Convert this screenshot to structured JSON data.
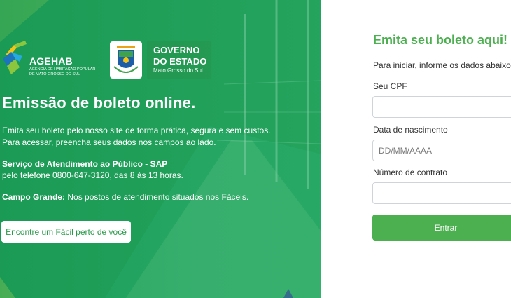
{
  "hero": {
    "agehab": {
      "name": "AGEHAB",
      "subtitle": "AGÊNCIA DE HABITAÇÃO POPULAR DE MATO GROSSO DO SUL"
    },
    "governo": {
      "line1": "GOVERNO",
      "line2": "DO ESTADO",
      "line3": "Mato Grosso do Sul"
    },
    "title": "Emissão de boleto online.",
    "description": "Emita seu boleto pelo nosso site de forma prática, segura e sem custos. Para acessar, preencha seus dados nos campos ao lado.",
    "sap_title": "Serviço de Atendimento ao Público - SAP",
    "sap_phone": "pelo telefone 0800-647-3120, das 8 às 13 horas.",
    "campo_grande_label": "Campo Grande:",
    "campo_grande_text": " Nos postos de atendimento situados nos Fáceis.",
    "find_button": "Encontre um Fácil perto de você"
  },
  "form": {
    "title": "Emita seu boleto aqui!",
    "subtitle": "Para iniciar, informe os dados abaixo:",
    "cpf_label": "Seu CPF",
    "cpf_value": "",
    "birth_label": "Data de nascimento",
    "birth_placeholder": "DD/MM/AAAA",
    "contract_label": "Número de contrato",
    "contract_value": "",
    "submit_label": "Entrar"
  },
  "colors": {
    "accent_green": "#4caf50",
    "hero_green": "#1ea25a"
  }
}
